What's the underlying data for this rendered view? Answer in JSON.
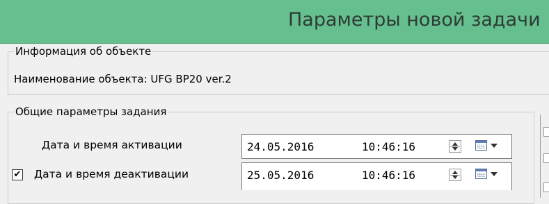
{
  "window": {
    "title": "Параметры новой задачи"
  },
  "object_info": {
    "legend": "Информация об объекте",
    "name_line": "Наименование объекта: UFG BP20 ver.2"
  },
  "task_params": {
    "legend": "Общие параметры задания",
    "activation": {
      "label": "Дата и время активации",
      "date": "24.05.2016",
      "time": "10:46:16"
    },
    "deactivation": {
      "label": "Дата и время деактивации",
      "checked_mark": "✔",
      "date": "25.05.2016",
      "time": "10:46:16"
    }
  },
  "icons": {
    "spinner": "up-down-spinner-icon",
    "calendar": "calendar-icon",
    "dropdown": "chevron-down-icon"
  },
  "colors": {
    "titlebar_bg": "#66bf8f",
    "title_text": "#2d3c35",
    "window_bg": "#f0f0f0"
  }
}
